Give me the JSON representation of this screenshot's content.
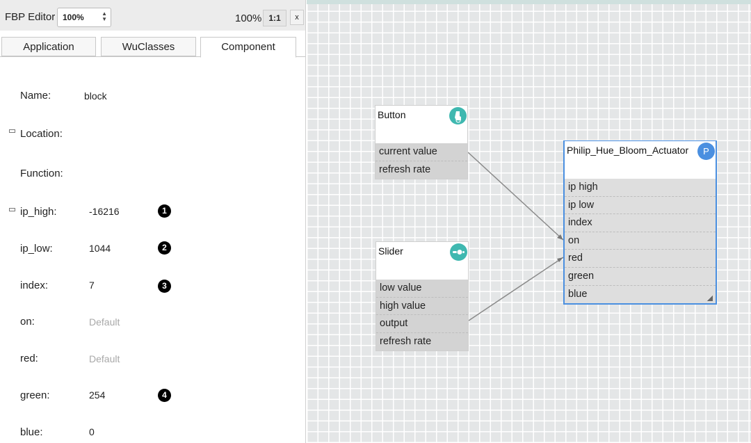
{
  "toolbar": {
    "title": "FBP Editor",
    "zoom_select": "100%",
    "zoom_level": "100%",
    "one_to_one": "1:1",
    "close": "x"
  },
  "tabs": [
    {
      "label": "Application",
      "active": false
    },
    {
      "label": "WuClasses",
      "active": false
    },
    {
      "label": "Component",
      "active": true
    }
  ],
  "properties": {
    "name": {
      "label": "Name:",
      "value": "block"
    },
    "location": {
      "label": "Location:"
    },
    "function": {
      "label": "Function:"
    },
    "ip_high": {
      "label": "ip_high:",
      "value": "-16216",
      "marker": "1"
    },
    "ip_low": {
      "label": "ip_low:",
      "value": "1044",
      "marker": "2"
    },
    "index": {
      "label": "index:",
      "value": "7",
      "marker": "3"
    },
    "on": {
      "label": "on:",
      "placeholder": "Default"
    },
    "red": {
      "label": "red:",
      "placeholder": "Default"
    },
    "green": {
      "label": "green:",
      "value": "254",
      "marker": "4"
    },
    "blue": {
      "label": "blue:",
      "value": "0"
    }
  },
  "nodes": {
    "button": {
      "title": "Button",
      "icon": "touch-hand-icon",
      "icon_color": "#3fb8b0",
      "ports": [
        "current value",
        "refresh rate"
      ]
    },
    "slider": {
      "title": "Slider",
      "icon": "slider-knob-icon",
      "icon_color": "#3fb8b0",
      "ports": [
        "low value",
        "high value",
        "output",
        "refresh rate"
      ]
    },
    "philip": {
      "title": "Philip_Hue_Bloom_Actuator",
      "icon": "letter-p-icon",
      "icon_label": "P",
      "icon_color": "#4a8fe0",
      "ports": [
        "ip high",
        "ip low",
        "index",
        "on",
        "red",
        "green",
        "blue"
      ]
    }
  },
  "links": [
    {
      "from": "button.current value",
      "to": "philip.on"
    },
    {
      "from": "slider.output",
      "to": "philip.red"
    }
  ],
  "colors": {
    "accent_blue": "#4a8fe0",
    "icon_teal": "#3fb8b0",
    "port_bg": "#d3d3d3",
    "canvas_bg": "#e4e6e7"
  }
}
